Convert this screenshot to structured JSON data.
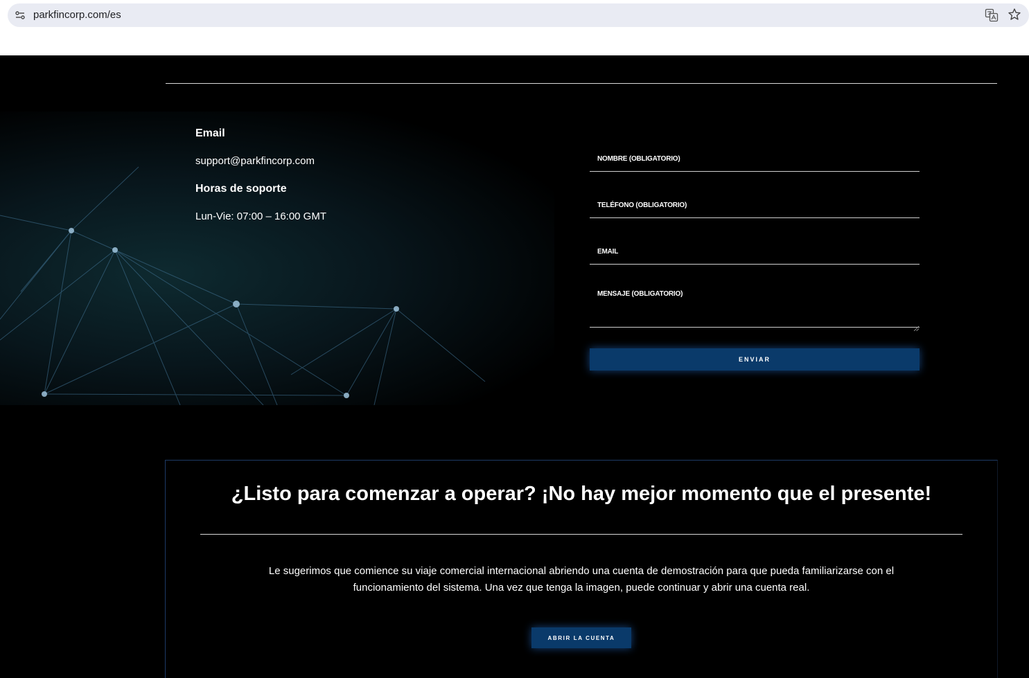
{
  "browser": {
    "url": "parkfincorp.com/es",
    "icons": [
      "site-info-icon",
      "translate-icon",
      "star-icon"
    ]
  },
  "contact": {
    "email_label": "Email",
    "email_value": "support@parkfincorp.com",
    "hours_label": "Horas de soporte",
    "hours_value": "Lun-Vie: 07:00 – 16:00 GMT"
  },
  "form": {
    "name_label": "NOMBRE (OBLIGATORIO)",
    "phone_label": "TELÉFONO (OBLIGATORIO)",
    "email_label": "EMAIL",
    "message_label": "MENSAJE (OBLIGATORIO)",
    "submit_label": "ENVIAR"
  },
  "cta": {
    "title": "¿Listo para comenzar a operar? ¡No hay mejor momento que el presente!",
    "text": "Le sugerimos que comience su viaje comercial internacional abriendo una cuenta de demostración para que pueda familiarizarse con el funcionamiento del sistema. Una vez que tenga la imagen, puede continuar y abrir una cuenta real.",
    "button_label": "ABRIR LA CUENTA"
  },
  "colors": {
    "background": "#000000",
    "accent_button": "#0a3a6a",
    "omnibox": "#e9ebf3"
  }
}
